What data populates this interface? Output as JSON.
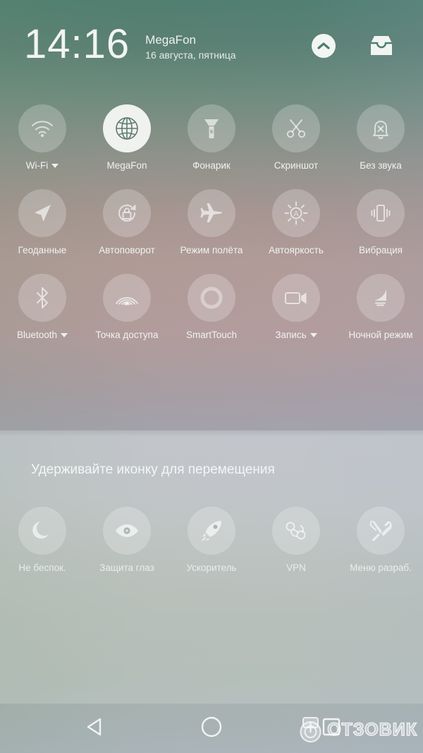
{
  "statusbar": {
    "time": "14:16",
    "carrier": "MegaFon",
    "date": "16 августа, пятница",
    "collapse_icon": "chevron-up-icon",
    "notifications_icon": "inbox-tray-icon"
  },
  "quick_settings": {
    "tiles": [
      {
        "id": "wifi",
        "label": "Wi-Fi",
        "icon": "wifi-icon",
        "active": false,
        "has_caret": true
      },
      {
        "id": "mobile-data",
        "label": "MegaFon",
        "icon": "globe-icon",
        "active": true,
        "has_caret": false
      },
      {
        "id": "flashlight",
        "label": "Фонарик",
        "icon": "flashlight-icon",
        "active": false,
        "has_caret": false
      },
      {
        "id": "screenshot",
        "label": "Скриншот",
        "icon": "scissors-icon",
        "active": false,
        "has_caret": false
      },
      {
        "id": "silent",
        "label": "Без звука",
        "icon": "bell-off-icon",
        "active": false,
        "has_caret": false
      },
      {
        "id": "location",
        "label": "Геоданные",
        "icon": "location-arrow-icon",
        "active": false,
        "has_caret": false
      },
      {
        "id": "autorotate",
        "label": "Автоповорот",
        "icon": "rotation-lock-icon",
        "active": false,
        "has_caret": false
      },
      {
        "id": "airplane",
        "label": "Режим полёта",
        "icon": "airplane-icon",
        "active": false,
        "has_caret": false
      },
      {
        "id": "brightness",
        "label": "Автояркость",
        "icon": "auto-brightness-icon",
        "active": false,
        "has_caret": false
      },
      {
        "id": "vibration",
        "label": "Вибрация",
        "icon": "vibration-icon",
        "active": false,
        "has_caret": false
      },
      {
        "id": "bluetooth",
        "label": "Bluetooth",
        "icon": "bluetooth-icon",
        "active": false,
        "has_caret": true
      },
      {
        "id": "hotspot",
        "label": "Точка доступа",
        "icon": "hotspot-icon",
        "active": false,
        "has_caret": false
      },
      {
        "id": "smarttouch",
        "label": "SmartTouch",
        "icon": "ring-icon",
        "active": false,
        "has_caret": false
      },
      {
        "id": "record",
        "label": "Запись",
        "icon": "video-camera-icon",
        "active": false,
        "has_caret": true
      },
      {
        "id": "nightmode",
        "label": "Ночной режим",
        "icon": "moon-water-icon",
        "active": false,
        "has_caret": false
      }
    ]
  },
  "edit_section": {
    "hint": "Удерживайте иконку для перемещения",
    "tiles": [
      {
        "id": "dnd",
        "label": "Не беспок.",
        "icon": "crescent-moon-icon",
        "active": false,
        "has_caret": false
      },
      {
        "id": "eye-care",
        "label": "Защита глаз",
        "icon": "eye-icon",
        "active": false,
        "has_caret": false
      },
      {
        "id": "booster",
        "label": "Ускоритель",
        "icon": "rocket-icon",
        "active": false,
        "has_caret": false
      },
      {
        "id": "vpn",
        "label": "VPN",
        "icon": "vpn-key-icon",
        "active": false,
        "has_caret": false
      },
      {
        "id": "devmenu",
        "label": "Меню разраб.",
        "icon": "tools-icon",
        "active": false,
        "has_caret": false
      }
    ]
  },
  "navbar": {
    "back_label": "back-button",
    "home_label": "home-button",
    "recents_label": "recents-button"
  },
  "watermark": {
    "text": "ОТЗОВИК"
  },
  "colors": {
    "accent_active_tile": "#f0f2ef",
    "active_glyph": "#5f7a72",
    "text": "#f0f3f0",
    "gradient_top": "#4d7d6e",
    "gradient_mid": "#b29b97",
    "gradient_bottom": "#acb6bb"
  }
}
